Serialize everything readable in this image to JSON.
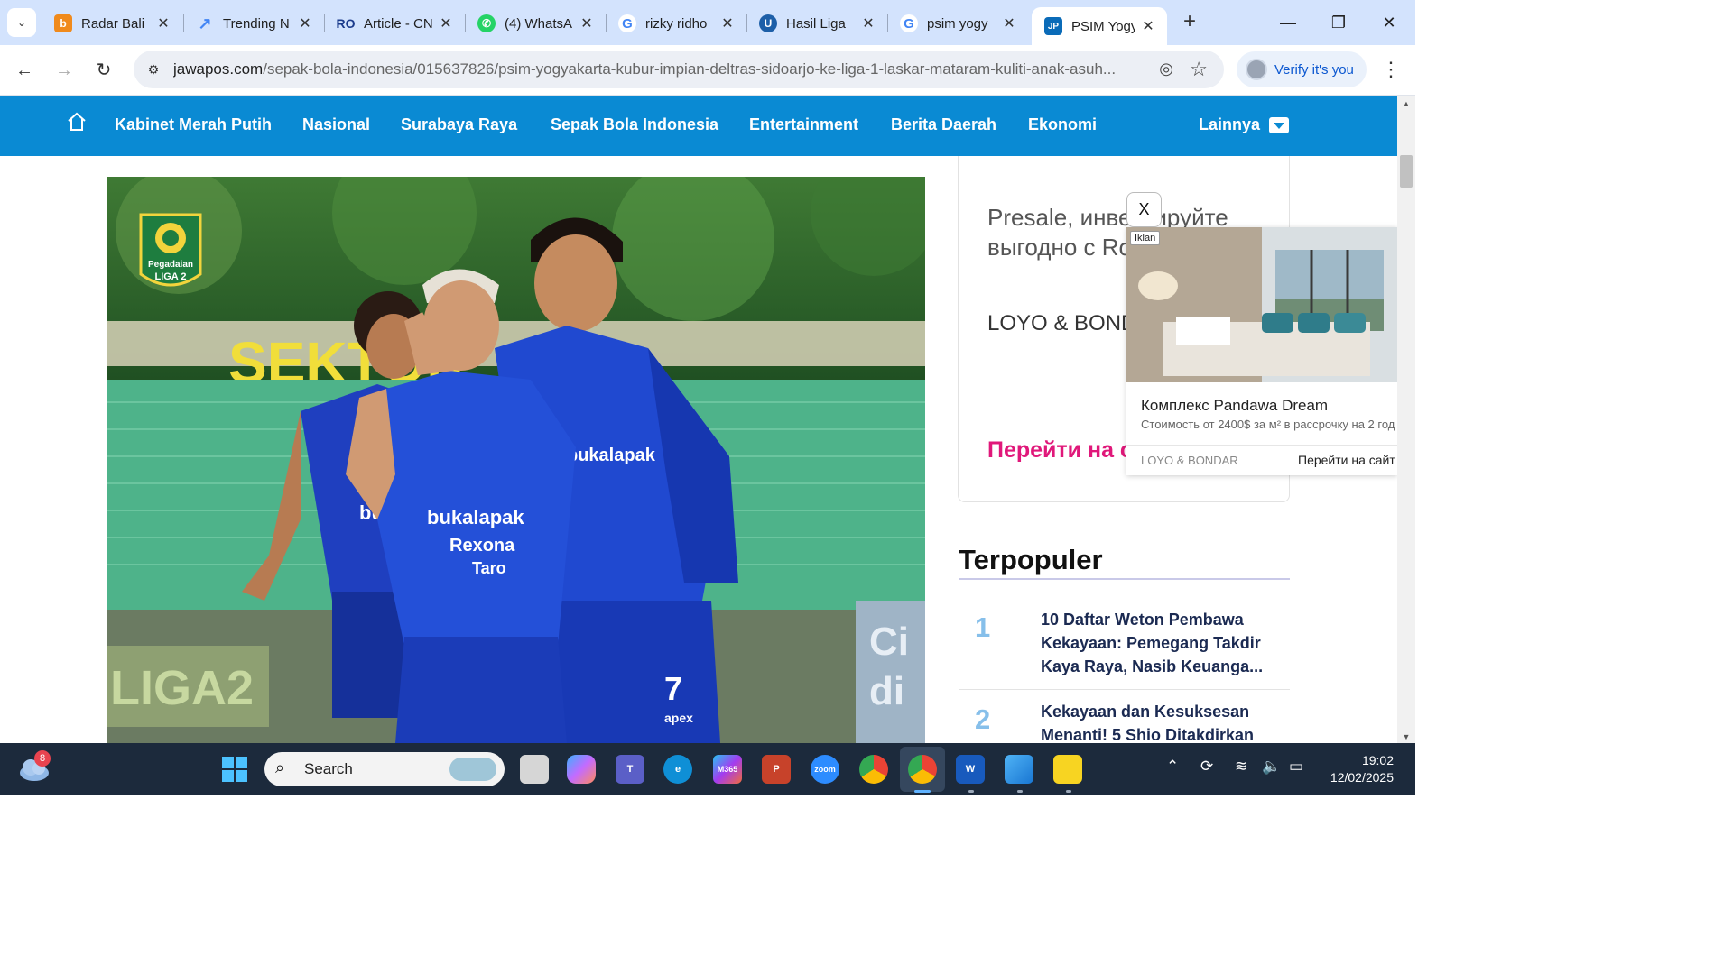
{
  "browser": {
    "tabs": [
      {
        "title": "Radar Bali",
        "favicon": "radar-bali-icon",
        "color": "#f08a1c",
        "glyph": "b"
      },
      {
        "title": "Trending N",
        "favicon": "trending-chart-icon",
        "color": "#4285f4",
        "glyph": "↗"
      },
      {
        "title": "Article - CN",
        "favicon": "article-cms-icon",
        "color": "#1b3b8c",
        "glyph": "R"
      },
      {
        "title": "(4) WhatsA",
        "favicon": "whatsapp-icon",
        "color": "#25d366",
        "glyph": "✆"
      },
      {
        "title": "rizky ridho",
        "favicon": "google-icon",
        "color": "#ffffff",
        "glyph": "G"
      },
      {
        "title": "Hasil Liga",
        "favicon": "unknown-site-icon",
        "color": "#1d5fa8",
        "glyph": "U"
      },
      {
        "title": "psim yogy",
        "favicon": "google-icon",
        "color": "#ffffff",
        "glyph": "G"
      },
      {
        "title": "PSIM Yogy",
        "favicon": "jawapos-icon",
        "color": "#0a6bb8",
        "glyph": "JP",
        "active": true
      }
    ],
    "url_domain": "jawapos.com",
    "url_path": "/sepak-bola-indonesia/015637826/psim-yogyakarta-kubur-impian-deltras-sidoarjo-ke-liga-1-laskar-mataram-kuliti-anak-asuh...",
    "verify_label": "Verify it's you"
  },
  "site_nav": {
    "items": [
      "Kabinet Merah Putih",
      "Nasional",
      "Surabaya Raya",
      "Sepak Bola Indonesia",
      "Entertainment",
      "Berita Daerah",
      "Ekonomi"
    ],
    "more_label": "Lainnya"
  },
  "hero": {
    "league_badge_line1": "Pegadaian",
    "league_badge_line2": "LIGA 2",
    "banner_text": "SEKTOR",
    "board_left": "LIGA2",
    "board_right_top": "Ci",
    "board_right_bottom": "di",
    "jersey_sponsor1": "bukalapak",
    "jersey_sponsor2": "Rexona",
    "jersey_sponsor3": "Taro",
    "jersey_brand": "apex",
    "jersey_number": "7"
  },
  "ad": {
    "text1": "Presale, инвестируйте выгодно с Ro",
    "text2": "LOYO & BOND",
    "cta_partial": "Перейти на с",
    "popup_label": "Iklan",
    "popup_close": "X",
    "popup_title": "Комплекс Pandawa Dream",
    "popup_sub": "Стоимость от 2400$ за м² в рассрочку на 2 год",
    "popup_brand": "LOYO & BONDAR",
    "popup_go": "Перейти на сайт"
  },
  "popular": {
    "title": "Terpopuler",
    "items": [
      {
        "num": "1",
        "text": "10 Daftar Weton Pembawa Kekayaan: Pemegang Takdir Kaya Raya, Nasib Keuanga..."
      },
      {
        "num": "2",
        "text": "Kekayaan dan Kesuksesan Menanti! 5 Shio Ditakdirkan"
      }
    ]
  },
  "taskbar": {
    "weather_badge": "8",
    "search_label": "Search",
    "apps": [
      "file-explorer-icon",
      "copilot-icon",
      "teams-icon",
      "edge-icon",
      "m365-icon",
      "powerpoint-icon",
      "zoom-icon",
      "chrome-icon",
      "chrome-profile-icon",
      "word-icon",
      "photos-icon",
      "sticky-notes-icon"
    ],
    "zoom_label": "zoom",
    "time": "19:02",
    "date": "12/02/2025"
  }
}
